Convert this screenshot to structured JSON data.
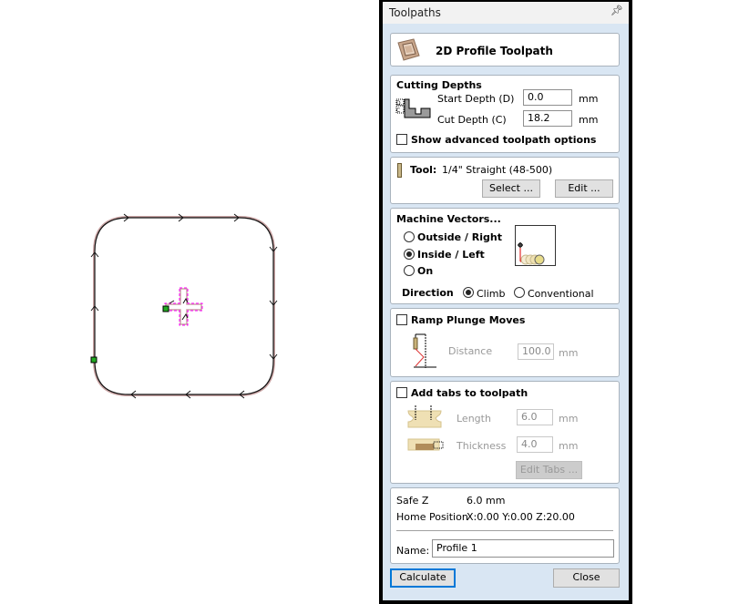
{
  "panel": {
    "title": "Toolpaths",
    "pin_icon": "pin-icon"
  },
  "header": {
    "icon": "profile-toolpath-icon",
    "title": "2D Profile Toolpath"
  },
  "cutting_depths": {
    "heading": "Cutting Depths",
    "icon": "depth-diagram-icon",
    "start_depth_label": "Start Depth (D)",
    "start_depth_value": "0.0",
    "cut_depth_label": "Cut Depth (C)",
    "cut_depth_value": "18.2",
    "unit": "mm",
    "advanced_label": "Show advanced toolpath options",
    "advanced_checked": false
  },
  "tool": {
    "icon": "end-mill-icon",
    "label": "Tool:",
    "value": "1/4\" Straight (48-500)",
    "select_label": "Select ...",
    "edit_label": "Edit ..."
  },
  "machine_vectors": {
    "heading": "Machine Vectors...",
    "options": [
      {
        "label": "Outside / Right",
        "selected": false
      },
      {
        "label": "Inside / Left",
        "selected": true
      },
      {
        "label": "On",
        "selected": false
      }
    ],
    "preview_icon": "cut-direction-preview-icon",
    "direction_label": "Direction",
    "direction_options": [
      {
        "label": "Climb",
        "selected": true
      },
      {
        "label": "Conventional",
        "selected": false
      }
    ]
  },
  "ramp": {
    "label": "Ramp Plunge Moves",
    "checked": false,
    "icon": "ramp-diagram-icon",
    "distance_label": "Distance",
    "distance_value": "100.0",
    "unit": "mm"
  },
  "tabs": {
    "label": "Add tabs to toolpath",
    "checked": false,
    "length_icon": "tab-length-icon",
    "thickness_icon": "tab-thickness-icon",
    "length_label": "Length",
    "length_value": "6.0",
    "thickness_label": "Thickness",
    "thickness_value": "4.0",
    "unit": "mm",
    "edit_tabs_label": "Edit Tabs ..."
  },
  "settings": {
    "safe_z_label": "Safe Z",
    "safe_z_value": "6.0 mm",
    "home_label": "Home Position",
    "home_value": "X:0.00 Y:0.00 Z:20.00",
    "name_label": "Name:",
    "name_value": "Profile 1"
  },
  "footer": {
    "calculate_label": "Calculate",
    "close_label": "Close"
  },
  "colors": {
    "panel_bg": "#d9e6f3",
    "accent": "#0078d7",
    "toolpath": "#000000",
    "vector": "#c8a0a0",
    "selection": "#ff00ff",
    "start_point": "#22aa22"
  }
}
